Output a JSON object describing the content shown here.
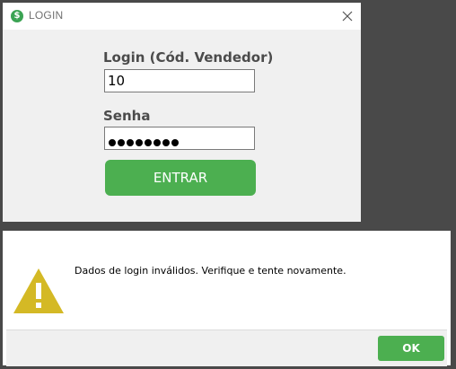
{
  "login_window": {
    "title": "LOGIN",
    "app_icon": "$",
    "close_icon": "close-icon",
    "login_label": "Login (Cód. Vendedor)",
    "login_value": "10",
    "password_label": "Senha",
    "password_mask_length": 8,
    "enter_button": "ENTRAR"
  },
  "message_box": {
    "icon": "warning-icon",
    "message": "Dados de login inválidos. Verifique e tente novamente.",
    "ok_button": "OK"
  },
  "colors": {
    "accent_green": "#4caf50",
    "warning_yellow": "#d4b925",
    "background": "#494949"
  }
}
